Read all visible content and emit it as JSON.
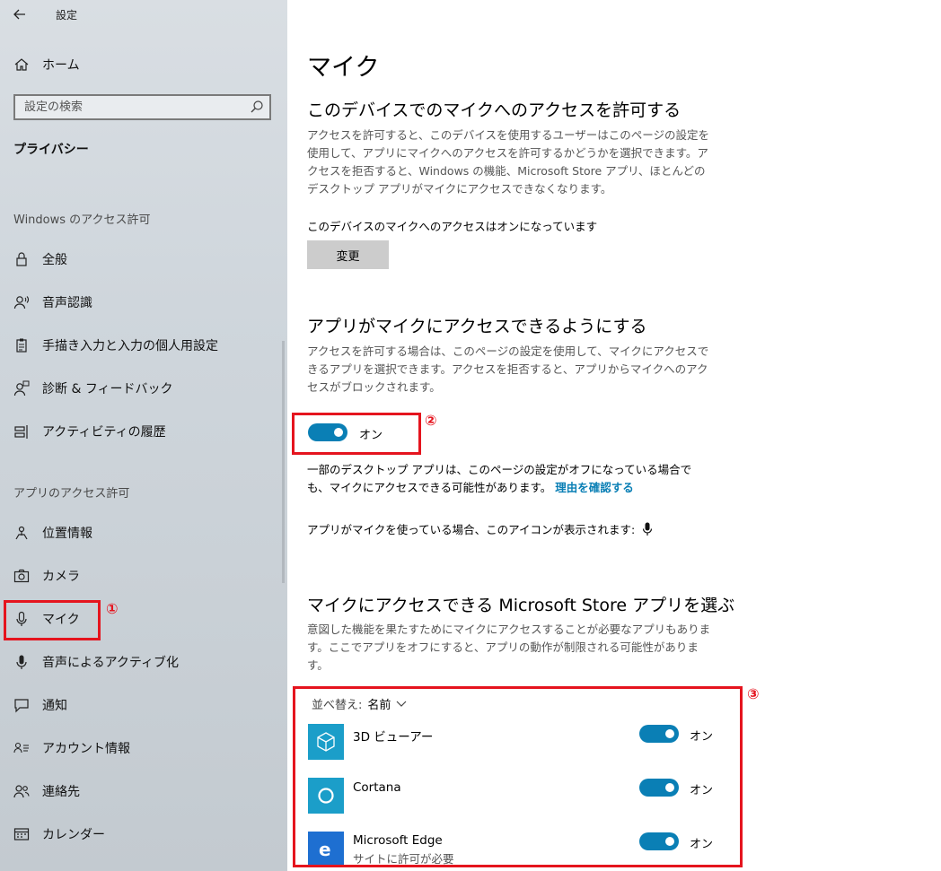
{
  "window": {
    "title": "設定",
    "back_icon": "back-arrow-icon"
  },
  "sidebar": {
    "home": {
      "label": "ホーム",
      "icon": "home-icon"
    },
    "search": {
      "placeholder": "設定の検索",
      "icon": "search-icon"
    },
    "section_title": "プライバシー",
    "groups": [
      {
        "heading": "Windows のアクセス許可",
        "items": [
          {
            "label": "全般",
            "icon": "lock-icon"
          },
          {
            "label": "音声認識",
            "icon": "speech-person-icon"
          },
          {
            "label": "手描き入力と入力の個人用設定",
            "icon": "clipboard-icon"
          },
          {
            "label": "診断 & フィードバック",
            "icon": "feedback-person-icon"
          },
          {
            "label": "アクティビティの履歴",
            "icon": "timeline-icon"
          }
        ]
      },
      {
        "heading": "アプリのアクセス許可",
        "items": [
          {
            "label": "位置情報",
            "icon": "location-icon"
          },
          {
            "label": "カメラ",
            "icon": "camera-icon"
          },
          {
            "label": "マイク",
            "icon": "microphone-icon",
            "selected": true
          },
          {
            "label": "音声によるアクティブ化",
            "icon": "microphone-filled-icon"
          },
          {
            "label": "通知",
            "icon": "notification-icon"
          },
          {
            "label": "アカウント情報",
            "icon": "account-info-icon"
          },
          {
            "label": "連絡先",
            "icon": "contacts-icon"
          },
          {
            "label": "カレンダー",
            "icon": "calendar-icon"
          }
        ]
      }
    ]
  },
  "annotations": {
    "callout1": "①",
    "callout2": "②",
    "callout3": "③",
    "color": "#e5141e"
  },
  "main": {
    "title": "マイク",
    "device": {
      "heading": "このデバイスでのマイクへのアクセスを許可する",
      "description": "アクセスを許可すると、このデバイスを使用するユーザーはこのページの設定を使用して、アプリにマイクへのアクセスを許可するかどうかを選択できます。アクセスを拒否すると、Windows の機能、Microsoft Store アプリ、ほとんどのデスクトップ アプリがマイクにアクセスできなくなります。",
      "status": "このデバイスのマイクへのアクセスはオンになっています",
      "change_button": "変更"
    },
    "apps_access": {
      "heading": "アプリがマイクにアクセスできるようにする",
      "description": "アクセスを許可する場合は、このページの設定を使用して、マイクにアクセスできるアプリを選択できます。アクセスを拒否すると、アプリからマイクへのアクセスがブロックされます。",
      "toggle_state": "オン",
      "desktop_note": "一部のデスクトップ アプリは、このページの設定がオフになっている場合でも、マイクにアクセスできる可能性があります。",
      "desktop_note_link": "理由を確認する",
      "icon_note": "アプリがマイクを使っている場合、このアイコンが表示されます:"
    },
    "store_apps": {
      "heading": "マイクにアクセスできる Microsoft Store アプリを選ぶ",
      "description": "意図した機能を果たすためにマイクにアクセスすることが必要なアプリもあります。ここでアプリをオフにすると、アプリの動作が制限される可能性があります。",
      "sort_label": "並べ替え:",
      "sort_value": "名前",
      "apps": [
        {
          "name": "3D ビューアー",
          "subtitle": "",
          "state": "オン",
          "icon": "3d-viewer-icon",
          "tile_color": "#1b9ec9"
        },
        {
          "name": "Cortana",
          "subtitle": "",
          "state": "オン",
          "icon": "cortana-icon",
          "tile_color": "#1b9ec9"
        },
        {
          "name": "Microsoft Edge",
          "subtitle": "サイトに許可が必要",
          "state": "オン",
          "icon": "edge-icon",
          "tile_color": "#1e6fd1"
        }
      ]
    }
  },
  "colors": {
    "accent": "#0a7fb5",
    "toggle_on": "#0a7fb5"
  }
}
